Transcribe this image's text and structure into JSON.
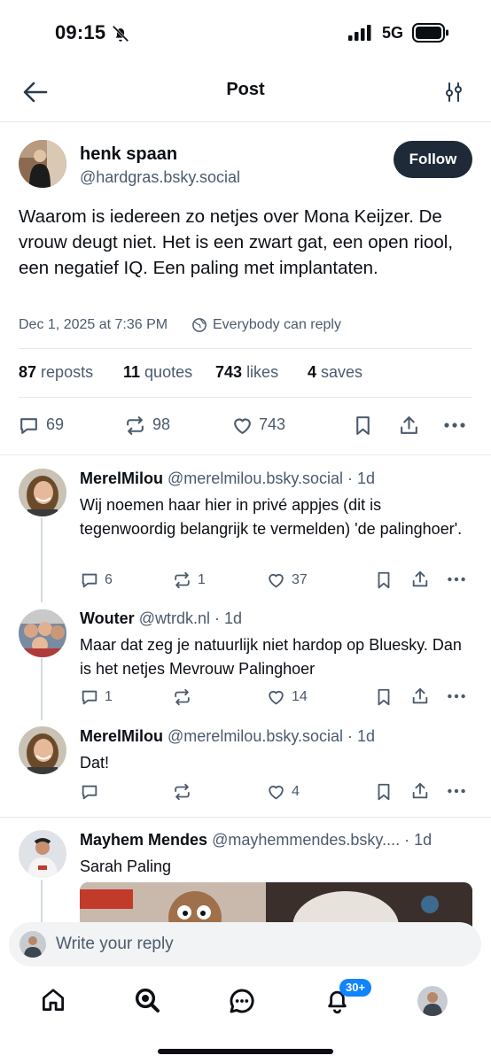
{
  "status_bar": {
    "time": "09:15",
    "network": "5G"
  },
  "header": {
    "title": "Post"
  },
  "post": {
    "author_name": "henk spaan",
    "author_handle": "@hardgras.bsky.social",
    "follow_label": "Follow",
    "text": "Waarom is iedereen zo netjes over Mona Keijzer. De vrouw deugt niet. Het is een zwart gat, een open riool, een negatief IQ. Een paling met implantaten.",
    "date": "Dec 1, 2025 at 7:36 PM",
    "reply_setting": "Everybody can reply",
    "stats": {
      "reposts_count": "87",
      "reposts_label": "reposts",
      "quotes_count": "11",
      "quotes_label": "quotes",
      "likes_count": "743",
      "likes_label": "likes",
      "saves_count": "4",
      "saves_label": "saves"
    },
    "actions": {
      "replies": "69",
      "reposts": "98",
      "likes": "743"
    }
  },
  "replies": [
    {
      "name": "MerelMilou",
      "handle": "@merelmilou.bsky.social",
      "time": "· 1d",
      "text": "Wij noemen haar hier in privé appjes (dit is tegenwoordig belangrijk te vermelden) 'de palinghoer'.",
      "replies": "6",
      "reposts": "1",
      "likes": "37"
    },
    {
      "name": "Wouter",
      "handle": "@wtrdk.nl",
      "time": "· 1d",
      "text": "Maar dat zeg je natuurlijk niet hardop op Bluesky. Dan is het netjes Mevrouw Palinghoer",
      "replies": "1",
      "reposts": "",
      "likes": "14"
    },
    {
      "name": "MerelMilou",
      "handle": "@merelmilou.bsky.social",
      "time": "· 1d",
      "text": "Dat!",
      "replies": "",
      "reposts": "",
      "likes": "4"
    },
    {
      "name": "Mayhem Mendes",
      "handle": "@mayhemmendes.bsky....",
      "time": "· 1d",
      "text": "Sarah Paling"
    }
  ],
  "composer": {
    "placeholder": "Write your reply"
  },
  "tab_bar": {
    "notifications_badge": "30+"
  },
  "colors": {
    "accent": "#1083fe",
    "follow_bg": "#1e2a38",
    "muted": "#4b5b6c"
  }
}
